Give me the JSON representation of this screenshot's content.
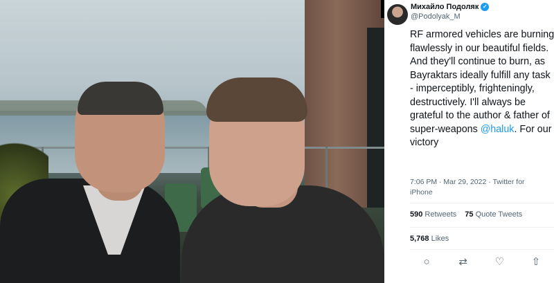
{
  "tweet": {
    "author_name": "Михайло Подоляк",
    "handle": "@Podolyak_M",
    "text_before": "RF armored vehicles are burning flawlessly in our beautiful fields. And they'll continue to burn, as Bayraktars ideally fulfill any task - imperceptibly, frighteningly, destructively. I'll always be grateful to the author & father of super-weapons ",
    "mention": "@haluk",
    "text_after": ". For our victory",
    "timestamp": "7:06 PM · Mar 29, 2022 · Twitter for iPhone",
    "retweets_count": "590",
    "retweets_label": "Retweets",
    "quote_count": "75",
    "quote_label": "Quote Tweets",
    "likes_count": "5,768",
    "likes_label": "Likes"
  },
  "icons": {
    "collapse": "»",
    "verified": "✓",
    "reply": "○",
    "retweet": "⇄",
    "like": "♡",
    "share": "⇧"
  },
  "colors": {
    "accent": "#1d9bf0",
    "text": "#0f1419",
    "secondary": "#536471"
  }
}
